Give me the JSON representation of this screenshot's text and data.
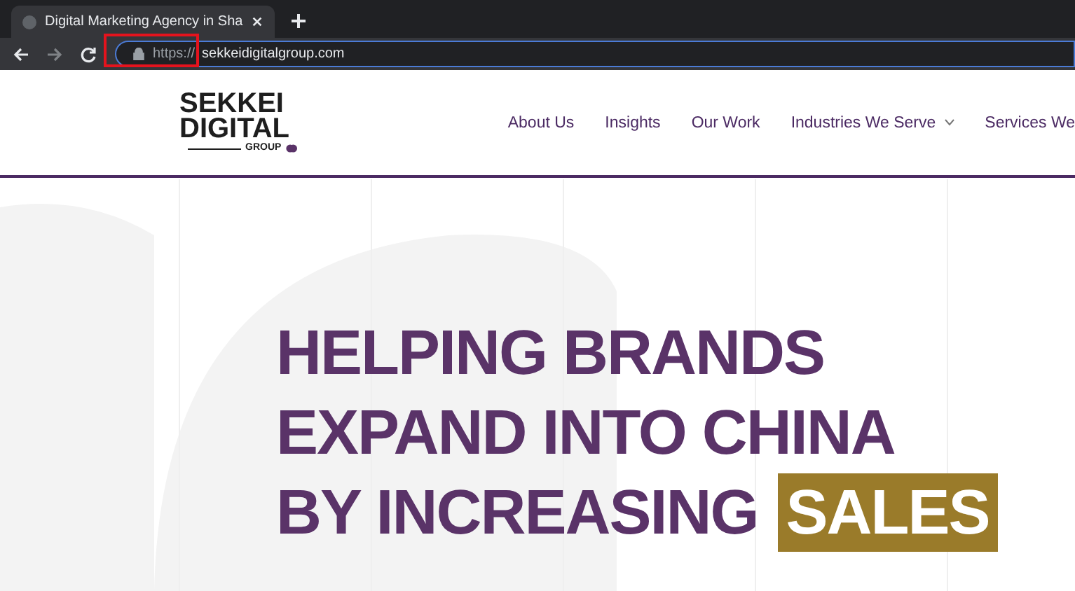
{
  "browser": {
    "tab": {
      "title": "Digital Marketing Agency in Sha",
      "selected": true
    },
    "url": {
      "scheme": "https://",
      "host": "sekkeidigitalgroup.com"
    }
  },
  "logo": {
    "line_1": "SEKKEI",
    "line_2": "DIGITAL",
    "line_3": "GROUP"
  },
  "nav": [
    {
      "label": "About Us",
      "dropdown": false
    },
    {
      "label": "Insights",
      "dropdown": false
    },
    {
      "label": "Our Work",
      "dropdown": false
    },
    {
      "label": "Industries We Serve",
      "dropdown": true
    },
    {
      "label": "Services We",
      "dropdown": false
    }
  ],
  "hero": {
    "lines": [
      "HELPING BRANDS",
      "EXPAND INTO CHINA",
      "BY INCREASING"
    ],
    "highlight": "SALES"
  }
}
